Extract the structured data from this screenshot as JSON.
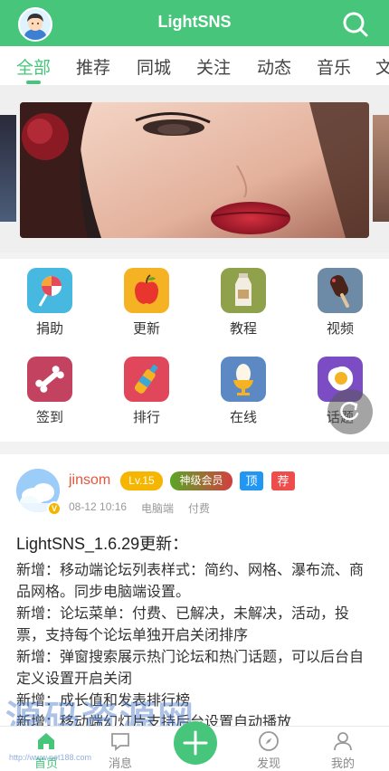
{
  "header": {
    "title": "LightSNS",
    "avatar_icon": "user-avatar-icon",
    "search_icon": "search-icon"
  },
  "tabs": [
    {
      "label": "全部",
      "active": true
    },
    {
      "label": "推荐"
    },
    {
      "label": "同城"
    },
    {
      "label": "关注"
    },
    {
      "label": "动态"
    },
    {
      "label": "音乐"
    },
    {
      "label": "文"
    }
  ],
  "grid": [
    {
      "label": "捐助",
      "icon": "lollipop-icon",
      "color": "#47b8e0"
    },
    {
      "label": "更新",
      "icon": "apple-icon",
      "color": "#f5b324"
    },
    {
      "label": "教程",
      "icon": "milk-carton-icon",
      "color": "#8fa14a"
    },
    {
      "label": "视频",
      "icon": "popsicle-icon",
      "color": "#6d8aa6"
    },
    {
      "label": "签到",
      "icon": "bone-icon",
      "color": "#c2425f"
    },
    {
      "label": "排行",
      "icon": "bottle-icon",
      "color": "#e1475a"
    },
    {
      "label": "在线",
      "icon": "egg-cup-icon",
      "color": "#5c88c4"
    },
    {
      "label": "话题",
      "icon": "fried-egg-icon",
      "color": "#7b4cc3"
    }
  ],
  "post": {
    "author": "jinsom",
    "level": "Lv.15",
    "vip": "神级会员",
    "top": "顶",
    "recommend": "荐",
    "date": "08-12 10:16",
    "source": "电脑端",
    "type": "付费",
    "verified": "V",
    "title": "LightSNS_1.6.29更新：",
    "lines": [
      "新增：移动端论坛列表样式：简约、网格、瀑布流、商品网格。同步电脑端设置。",
      "新增：论坛菜单：付费、已解决，未解决，活动，投票，支持每个论坛单独开启关闭排序",
      "新增：弹窗搜索展示热门论坛和热门话题，可以后台自定义设置开启关闭",
      "新增：成长值和发表排行榜",
      "新增：移动端幻灯片支持后台设置自动播放"
    ]
  },
  "bottom_nav": [
    {
      "label": "首页",
      "icon": "home-icon",
      "active": true
    },
    {
      "label": "消息",
      "icon": "message-icon"
    },
    {
      "label": "",
      "icon": "add-icon"
    },
    {
      "label": "发现",
      "icon": "compass-icon"
    },
    {
      "label": "我的",
      "icon": "user-icon"
    }
  ],
  "watermark": {
    "text": "源码资源网",
    "sub": "http://www.net188.com"
  },
  "colors": {
    "brand": "#47c67b"
  }
}
